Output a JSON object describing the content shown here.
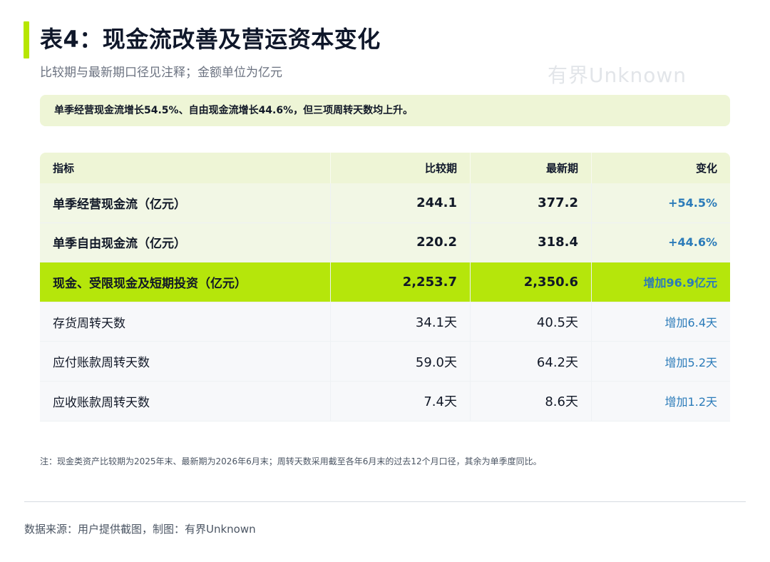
{
  "header": {
    "title": "表4：现金流改善及营运资本变化",
    "subtitle": "比较期与最新期口径见注释；金额单位为亿元",
    "watermark": "有界Unknown",
    "accent_color": "#b7e600"
  },
  "summary": {
    "text": "单季经营现金流增长54.5%、自由现金流增长44.6%，但三项周转天数均上升。"
  },
  "table": {
    "columns": [
      "指标",
      "比较期",
      "最新期",
      "变化"
    ],
    "rows": [
      {
        "metric": "单季经营现金流（亿元）",
        "prior": "244.1",
        "latest": "377.2",
        "change": "+54.5%",
        "style": "green"
      },
      {
        "metric": "单季自由现金流（亿元）",
        "prior": "220.2",
        "latest": "318.4",
        "change": "+44.6%",
        "style": "green"
      },
      {
        "metric": "现金、受限现金及短期投资（亿元）",
        "prior": "2,253.7",
        "latest": "2,350.6",
        "change": "增加96.9亿元",
        "style": "highlight"
      },
      {
        "metric": "存货周转天数",
        "prior": "34.1天",
        "latest": "40.5天",
        "change": "增加6.4天",
        "style": "gray"
      },
      {
        "metric": "应付账款周转天数",
        "prior": "59.0天",
        "latest": "64.2天",
        "change": "增加5.2天",
        "style": "gray"
      },
      {
        "metric": "应收账款周转天数",
        "prior": "7.4天",
        "latest": "8.6天",
        "change": "增加1.2天",
        "style": "gray"
      }
    ],
    "colors": {
      "header_bg": "#eef5d6",
      "green_row_bg": "#f2f7e5",
      "highlight_row_bg": "#b5e60b",
      "gray_row_bg": "#f7f8fa",
      "change_text": "#2b7bb9"
    }
  },
  "footnote": "注：现金类资产比较期为2025年末、最新期为2026年6月末；周转天数采用截至各年6月末的过去12个月口径，其余为单季度同比。",
  "source": "数据来源：用户提供截图，制图：有界Unknown"
}
